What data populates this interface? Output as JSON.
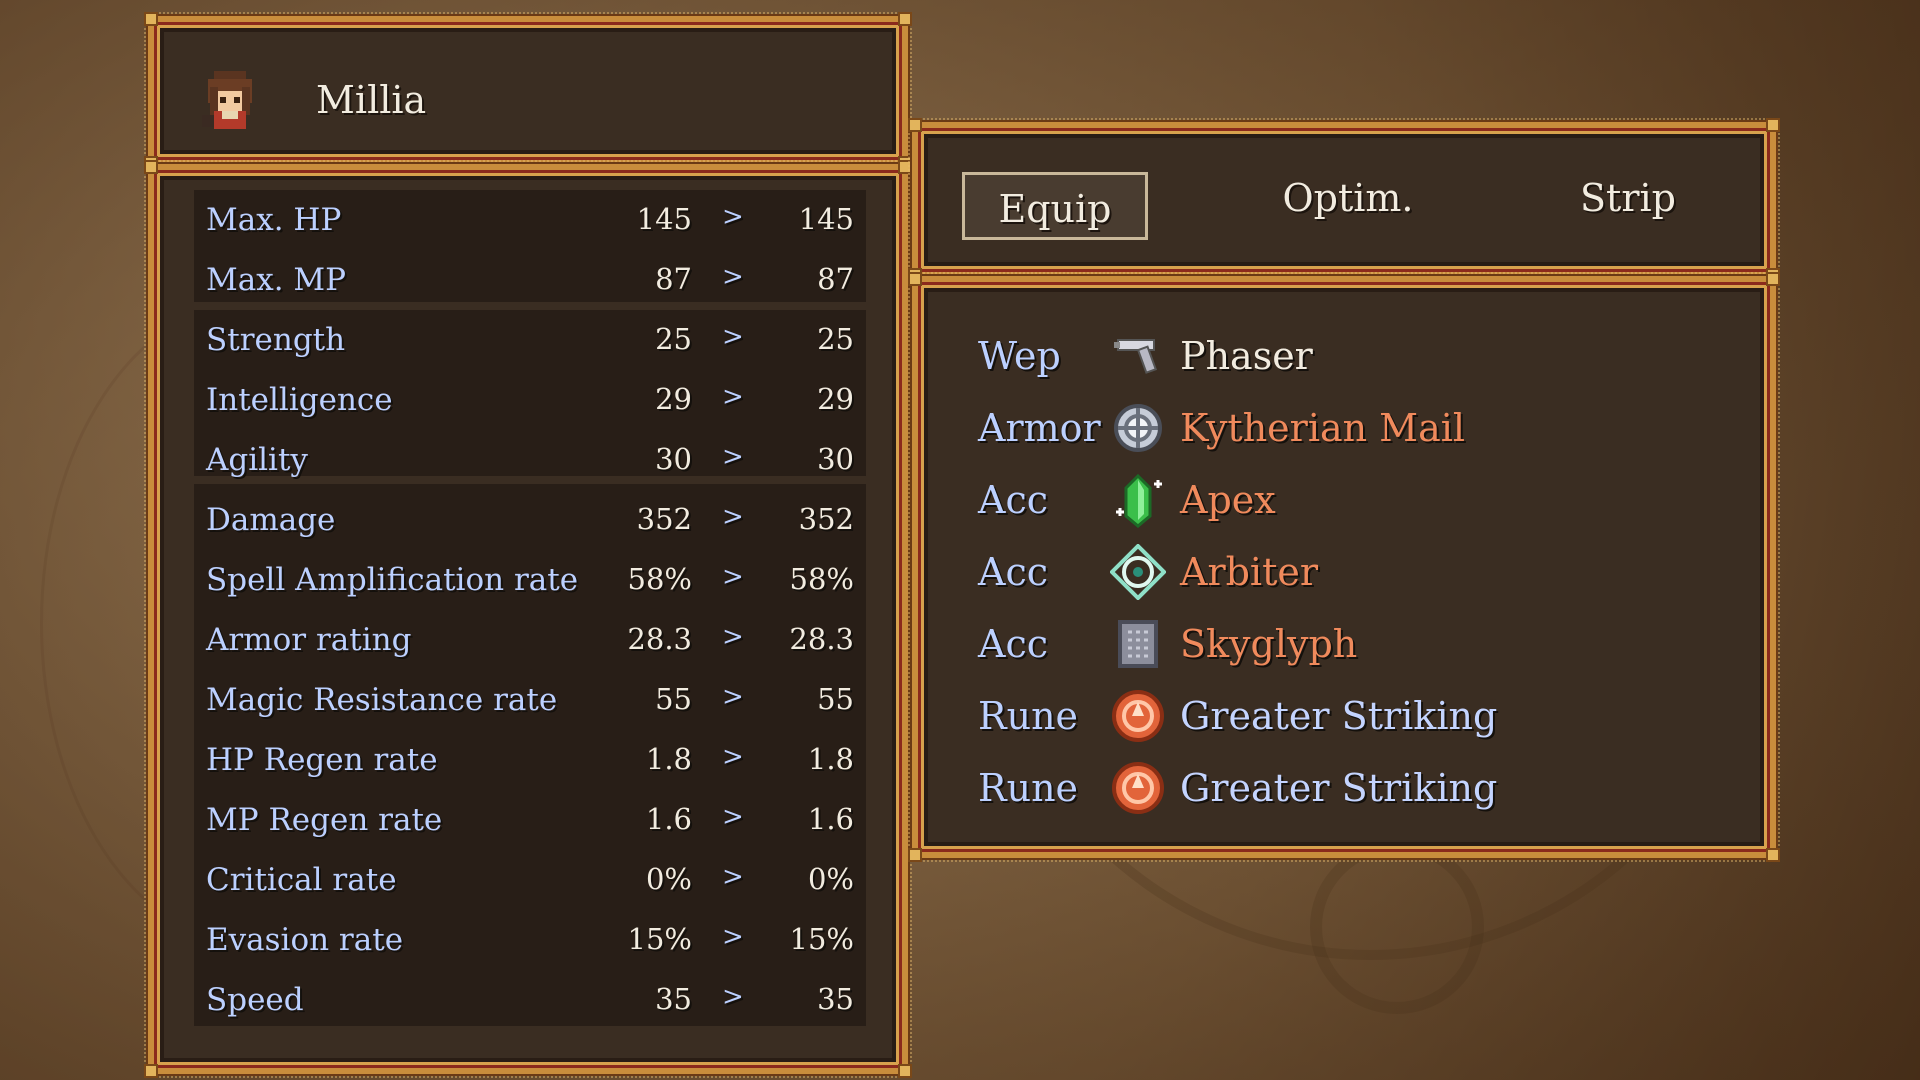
{
  "character": {
    "name": "Millia"
  },
  "stats": [
    {
      "label": "Max. HP",
      "current": "145",
      "new": "145"
    },
    {
      "label": "Max. MP",
      "current": "87",
      "new": "87"
    },
    {
      "label": "Strength",
      "current": "25",
      "new": "25"
    },
    {
      "label": "Intelligence",
      "current": "29",
      "new": "29"
    },
    {
      "label": "Agility",
      "current": "30",
      "new": "30"
    },
    {
      "label": "Damage",
      "current": "352",
      "new": "352"
    },
    {
      "label": "Spell Amplification rate",
      "current": "58%",
      "new": "58%"
    },
    {
      "label": "Armor rating",
      "current": "28.3",
      "new": "28.3"
    },
    {
      "label": "Magic Resistance rate",
      "current": "55",
      "new": "55"
    },
    {
      "label": "HP Regen rate",
      "current": "1.8",
      "new": "1.8"
    },
    {
      "label": "MP Regen rate",
      "current": "1.6",
      "new": "1.6"
    },
    {
      "label": "Critical rate",
      "current": "0%",
      "new": "0%"
    },
    {
      "label": "Evasion rate",
      "current": "15%",
      "new": "15%"
    },
    {
      "label": "Speed",
      "current": "35",
      "new": "35"
    }
  ],
  "stat_arrow": ">",
  "commands": {
    "equip": "Equip",
    "optim": "Optim.",
    "strip": "Strip"
  },
  "slots": [
    {
      "slot": "Wep",
      "item": "Phaser",
      "icon": "pistol-icon",
      "color": "#f2ece0"
    },
    {
      "slot": "Armor",
      "item": "Kytherian Mail",
      "icon": "armor-orb-icon",
      "color": "#f08a5c"
    },
    {
      "slot": "Acc",
      "item": "Apex",
      "icon": "green-crystal-icon",
      "color": "#f08a5c"
    },
    {
      "slot": "Acc",
      "item": "Arbiter",
      "icon": "target-sigil-icon",
      "color": "#f08a5c"
    },
    {
      "slot": "Acc",
      "item": "Skyglyph",
      "icon": "stone-tablet-icon",
      "color": "#f08a5c"
    },
    {
      "slot": "Rune",
      "item": "Greater Striking",
      "icon": "rune-icon",
      "color": "#c4d4ff"
    },
    {
      "slot": "Rune",
      "item": "Greater Striking",
      "icon": "rune-icon",
      "color": "#c4d4ff"
    }
  ],
  "colors": {
    "label_blue": "#bcd0ff",
    "rare_item": "#f08a5c",
    "frame_gold": "#c98d3c",
    "frame_red": "#8b2a1c"
  }
}
